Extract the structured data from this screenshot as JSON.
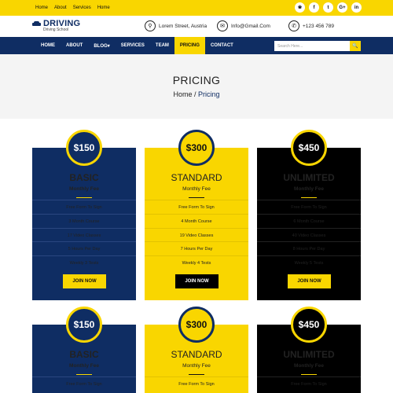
{
  "top_links": [
    "Home",
    "About",
    "Services",
    "Home"
  ],
  "social_icons": [
    "rss-icon",
    "facebook-icon",
    "twitter-icon",
    "google-plus-icon",
    "linkedin-icon"
  ],
  "social_glyphs": [
    "❀",
    "f",
    "t",
    "G+",
    "in"
  ],
  "brand": {
    "title": "DRIVING",
    "subtitle": "Driving School"
  },
  "contacts": {
    "address": "Lorem Street, Austria",
    "email": "Info@Gmail.Com",
    "phone": "+123 456 789"
  },
  "nav": {
    "items": [
      "HOME",
      "ABOUT",
      "BLOG▾",
      "SERVICES",
      "TEAM",
      "PRICING",
      "CONTACT"
    ],
    "active": "PRICING",
    "search_placeholder": "Search Here..."
  },
  "banner": {
    "title": "PRICING",
    "crumb_home": "Home",
    "crumb_sep": " / ",
    "crumb_current": "Pricing"
  },
  "plans": [
    {
      "price": "$150",
      "name": "BASIC",
      "sub": "Monthly Fee",
      "features": [
        "Free Form To Sign",
        "3 Month Course",
        "17 Video Classes",
        "5 Hours Per Day",
        "Weekly 3 Tests"
      ],
      "cta": "JOIN NOW"
    },
    {
      "price": "$300",
      "name": "STANDARD",
      "sub": "Monthly Fee",
      "features": [
        "Free Form To Sign",
        "4 Month Course",
        "19 Video Classes",
        "7 Hours Per Day",
        "Weekly 4 Tests"
      ],
      "cta": "JOIN NOW"
    },
    {
      "price": "$450",
      "name": "UNLIMITED",
      "sub": "Monthly Fee",
      "features": [
        "Free Form To Sign",
        "6 Month Course",
        "40 Video Classes",
        "8 Hours Per Day",
        "Weekly 5 Tests"
      ],
      "cta": "JOIN NOW"
    }
  ],
  "plans_row2": [
    {
      "price": "$150",
      "name": "BASIC",
      "sub": "Monthly Fee",
      "features": [
        "Free Form To Sign"
      ]
    },
    {
      "price": "$300",
      "name": "STANDARD",
      "sub": "Monthly Fee",
      "features": [
        "Free Form To Sign"
      ]
    },
    {
      "price": "$450",
      "name": "UNLIMITED",
      "sub": "Monthly Fee",
      "features": [
        "Free Form To Sign"
      ]
    }
  ],
  "colors": {
    "navy": "#0f2d63",
    "yellow": "#f9d600",
    "black": "#000000"
  }
}
